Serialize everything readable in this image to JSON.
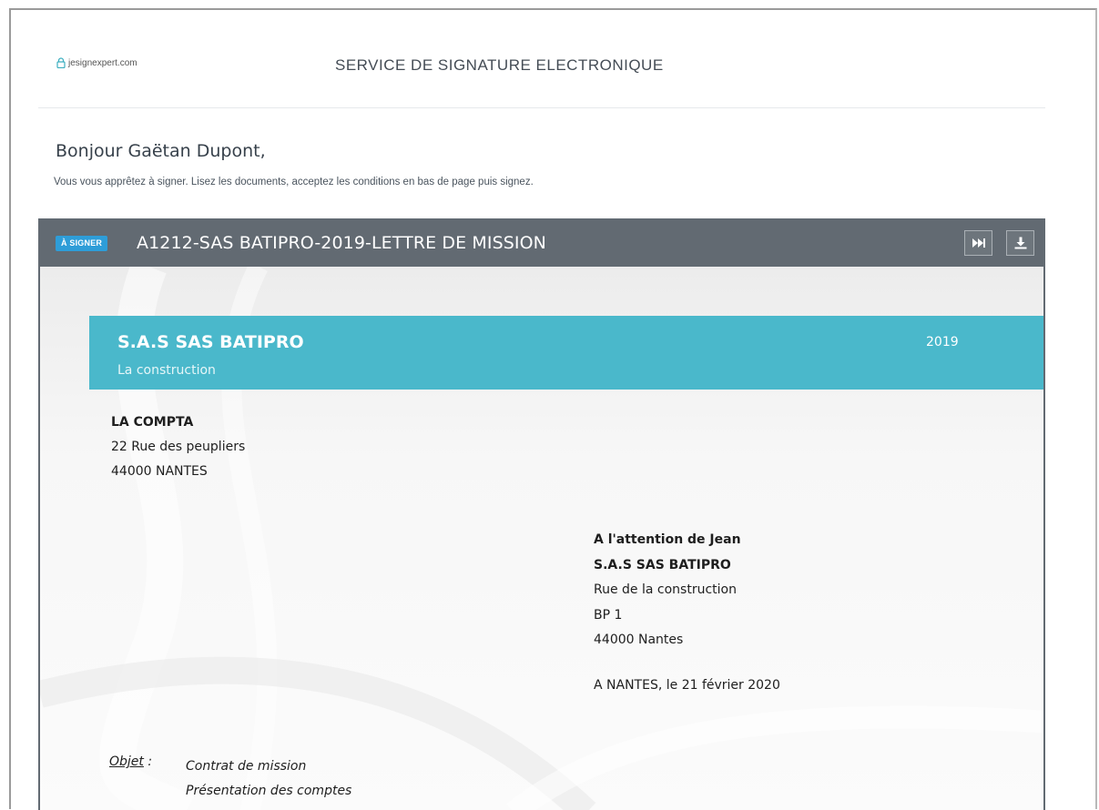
{
  "header": {
    "logo_text": "jesignexpert.com",
    "service_title": "SERVICE DE SIGNATURE ELECTRONIQUE"
  },
  "intro": {
    "greeting": "Bonjour Gaëtan Dupont,",
    "instructions": "Vous vous apprêtez à signer. Lisez les documents, acceptez les conditions en bas de page puis signez."
  },
  "document": {
    "status_badge": "À SIGNER",
    "title": "A1212-SAS BATIPRO-2019-LETTRE DE MISSION",
    "actions": [
      {
        "name": "next",
        "icon": "skip-forward-icon"
      },
      {
        "name": "download",
        "icon": "download-icon"
      }
    ],
    "banner": {
      "company": "S.A.S SAS BATIPRO",
      "subtitle": "La construction",
      "year": "2019"
    },
    "sender": {
      "name": "LA COMPTA",
      "street": "22 Rue des peupliers",
      "city": "44000 NANTES"
    },
    "recipient": {
      "attention": "A l'attention de Jean",
      "company": "S.A.S SAS BATIPRO",
      "street": "Rue de la construction",
      "po_box": "BP 1",
      "city": "44000 Nantes"
    },
    "date_line": "A NANTES, le 21 février 2020",
    "objet": {
      "label": "Objet",
      "separator": " :",
      "line1": "Contrat de mission",
      "line2": "Présentation des comptes"
    }
  },
  "colors": {
    "accent_banner": "#4ab8cb",
    "header_bar": "#626a72",
    "badge": "#2e9dd8"
  }
}
